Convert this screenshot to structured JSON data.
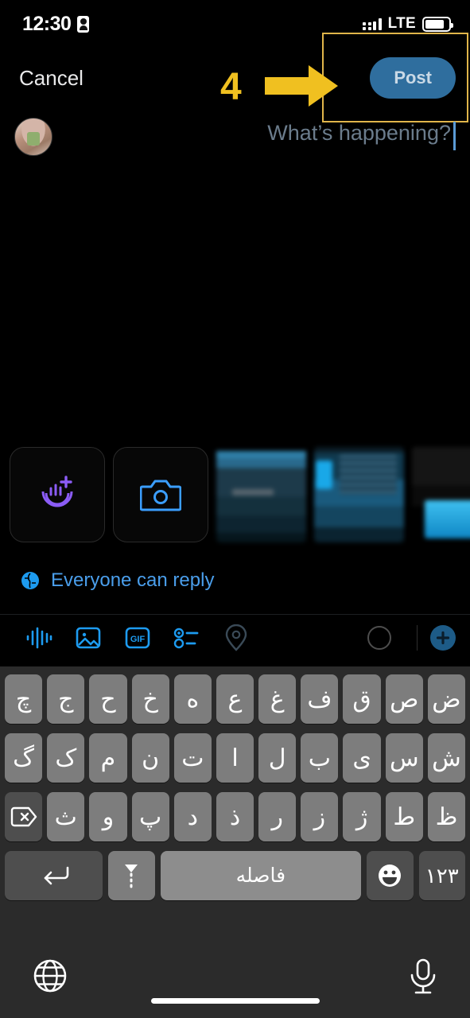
{
  "status_bar": {
    "time": "12:30",
    "badge_icon": "contact-badge-icon",
    "network": "LTE",
    "signal_icon": "signal-strength-icon",
    "battery_icon": "battery-icon"
  },
  "nav": {
    "cancel_label": "Cancel",
    "post_label": "Post",
    "post_color": "#2f6e9e",
    "post_text_color": "#c9d9e6"
  },
  "annotation": {
    "step_number": "4",
    "color": "#f0c020",
    "highlight_border_color": "#e0b54a",
    "arrow_icon": "right-arrow-annotation"
  },
  "composer": {
    "avatar": "user-avatar",
    "placeholder": "?What’s happening",
    "placeholder_color": "#6b7c8c",
    "caret_color": "#5b9bd5",
    "value": ""
  },
  "media": {
    "buttons": [
      {
        "name": "create-audio-button",
        "icon": "audio-add-icon",
        "color": "#8b5cf6"
      },
      {
        "name": "camera-button",
        "icon": "camera-icon",
        "color": "#3b9eff"
      }
    ],
    "thumbnails": [
      {
        "name": "gallery-thumbnail-1"
      },
      {
        "name": "gallery-thumbnail-2"
      },
      {
        "name": "gallery-thumbnail-3"
      }
    ]
  },
  "reply_setting": {
    "icon": "globe-icon",
    "label": "Everyone can reply",
    "color": "#4a9eeb"
  },
  "toolbar": {
    "items": [
      {
        "name": "audio-waveform-button",
        "icon": "waveform-icon",
        "color": "#1d9bf0",
        "enabled": true
      },
      {
        "name": "image-button",
        "icon": "image-icon",
        "color": "#1d9bf0",
        "enabled": true
      },
      {
        "name": "gif-button",
        "icon": "gif-icon",
        "label": "GIF",
        "color": "#1d9bf0",
        "enabled": true
      },
      {
        "name": "poll-button",
        "icon": "poll-icon",
        "color": "#1d9bf0",
        "enabled": true
      },
      {
        "name": "location-button",
        "icon": "location-pin-icon",
        "color": "#3a4a57",
        "enabled": false
      }
    ],
    "character_counter": "character-count-circle",
    "add_post_label": "+",
    "add_post_color": "#1d5b87"
  },
  "keyboard": {
    "language": "persian",
    "rows": [
      [
        "چ",
        "ج",
        "ح",
        "خ",
        "ه",
        "ع",
        "غ",
        "ف",
        "ق",
        "ص",
        "ض"
      ],
      [
        "گ",
        "ک",
        "م",
        "ن",
        "ت",
        "ا",
        "ل",
        "ب",
        "ی",
        "س",
        "ش"
      ],
      [
        "بک‌اسپیس",
        "ث",
        "و",
        "پ",
        "د",
        "ذ",
        "ر",
        "ز",
        "ژ",
        "ط",
        "ظ"
      ]
    ],
    "backspace_icon": "backspace-icon",
    "bottom_row": {
      "enter_icon": "return-key-icon",
      "dotted_arrow_icon": "dotted-down-arrow-icon",
      "space_label": "فاصله",
      "emoji_icon": "emoji-face-icon",
      "numbers_label": "۱۲۳"
    }
  },
  "bottom_bar": {
    "globe_icon": "language-globe-icon",
    "mic_icon": "microphone-icon",
    "home_indicator": "home-indicator"
  }
}
